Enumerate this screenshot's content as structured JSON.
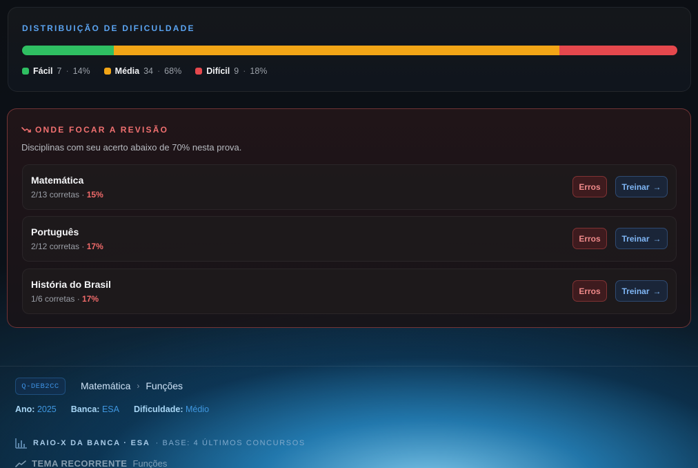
{
  "distribution": {
    "title": "DISTRIBUIÇÃO DE DIFICULDADE",
    "segments": [
      {
        "label": "Fácil",
        "count": "7",
        "pct": "14%",
        "fraction": 0.14,
        "color": "#2fbf62"
      },
      {
        "label": "Média",
        "count": "34",
        "pct": "68%",
        "fraction": 0.68,
        "color": "#f2a516"
      },
      {
        "label": "Difícil",
        "count": "9",
        "pct": "18%",
        "fraction": 0.18,
        "color": "#e5484d"
      }
    ]
  },
  "focus": {
    "title": "ONDE FOCAR A REVISÃO",
    "subtitle": "Disciplinas com seu acerto abaixo de 70% nesta prova.",
    "items": [
      {
        "name": "Matemática",
        "correct": "2/13 corretas",
        "pct": "15%",
        "erros_label": "Erros",
        "treinar_label": "Treinar"
      },
      {
        "name": "Português",
        "correct": "2/12 corretas",
        "pct": "17%",
        "erros_label": "Erros",
        "treinar_label": "Treinar"
      },
      {
        "name": "História do Brasil",
        "correct": "1/6 corretas",
        "pct": "17%",
        "erros_label": "Erros",
        "treinar_label": "Treinar"
      }
    ]
  },
  "question": {
    "id": "Q-DEB2CC",
    "breadcrumb": [
      "Matemática",
      "Funções"
    ],
    "meta": [
      {
        "key": "Ano:",
        "value": "2025"
      },
      {
        "key": "Banca:",
        "value": "ESA"
      },
      {
        "key": "Dificuldade:",
        "value": "Médio"
      }
    ]
  },
  "raio_x": {
    "label": "RAIO-X DA BANCA · ESA",
    "base": "· BASE: 4 ÚLTIMOS CONCURSOS",
    "icon": "bar-chart-icon"
  },
  "tema": {
    "label": "TEMA RECORRENTE",
    "topic": "Funções",
    "icon": "trend-up-icon"
  },
  "colors": {
    "accent_blue": "#5aa3f0",
    "focus_red": "#f07070"
  }
}
